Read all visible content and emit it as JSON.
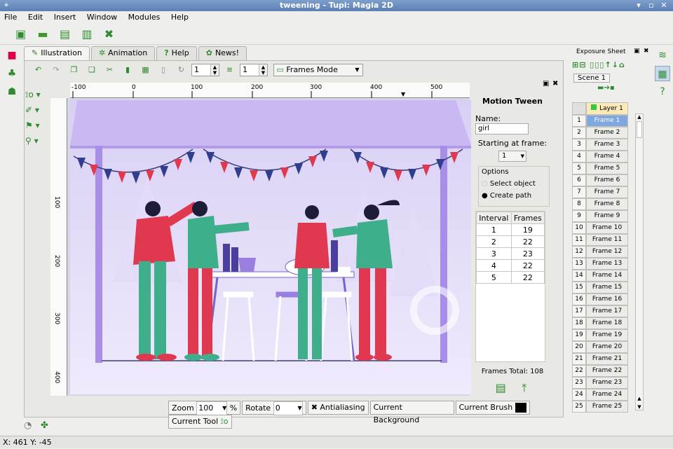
{
  "window": {
    "title": "tweening - Tupi: Magia 2D",
    "controls": [
      "▾",
      "▫",
      "✕"
    ]
  },
  "menu": [
    "File",
    "Edit",
    "Insert",
    "Window",
    "Modules",
    "Help"
  ],
  "tabs": [
    "Illustration",
    "Animation",
    "Help",
    "News!"
  ],
  "toolbar": {
    "spin1": "1",
    "spin2": "1",
    "mode": "Frames Mode"
  },
  "ruler_h": [
    "-100",
    "0",
    "100",
    "200",
    "300",
    "400",
    "500"
  ],
  "ruler_v": [
    "100",
    "200",
    "300",
    "400"
  ],
  "statusbar": {
    "zoom_label": "Zoom",
    "zoom_value": "100",
    "percent": "%",
    "rotate_label": "Rotate",
    "rotate_value": "0",
    "antialiasing": "Antialiasing",
    "current_background": "Current Background",
    "current_brush": "Current Brush",
    "current_tool": "Current Tool"
  },
  "tween": {
    "title": "Motion Tween",
    "name_label": "Name:",
    "name_value": "girl",
    "start_label": "Starting at frame:",
    "start_value": "1",
    "options_label": "Options",
    "opt1": "Select object",
    "opt2": "Create path",
    "headers": [
      "Interval",
      "Frames"
    ],
    "rows": [
      [
        "1",
        "19"
      ],
      [
        "2",
        "22"
      ],
      [
        "3",
        "23"
      ],
      [
        "4",
        "22"
      ],
      [
        "5",
        "22"
      ]
    ],
    "total": "Frames Total: 108"
  },
  "exposure": {
    "title": "Exposure Sheet",
    "scene": "Scene 1",
    "layer": "Layer 1",
    "frames": [
      "Frame 1",
      "Frame 2",
      "Frame 3",
      "Frame 4",
      "Frame 5",
      "Frame 6",
      "Frame 7",
      "Frame 8",
      "Frame 9",
      "Frame 10",
      "Frame 11",
      "Frame 12",
      "Frame 13",
      "Frame 14",
      "Frame 15",
      "Frame 16",
      "Frame 17",
      "Frame 18",
      "Frame 19",
      "Frame 20",
      "Frame 21",
      "Frame 22",
      "Frame 23",
      "Frame 24",
      "Frame 25"
    ],
    "numbers": [
      "1",
      "2",
      "3",
      "4",
      "5",
      "6",
      "7",
      "8",
      "9",
      "10",
      "11",
      "12",
      "13",
      "14",
      "15",
      "16",
      "17",
      "18",
      "19",
      "20",
      "21",
      "22",
      "23",
      "24",
      "25"
    ]
  },
  "coords": "X: 461 Y: -45",
  "colors": {
    "accent": "#2e8b2e",
    "selected": "#7fa7e0",
    "stage_top": "#d8d0f4",
    "green_figure": "#3fae8a",
    "red_figure": "#e0384f"
  }
}
